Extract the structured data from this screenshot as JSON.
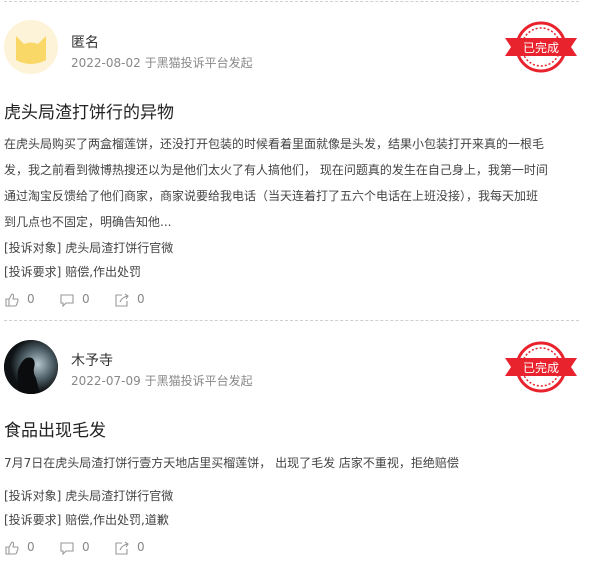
{
  "posts": [
    {
      "user": "匿名",
      "date": "2022-08-02",
      "platform_note": "于黑猫投诉平台发起",
      "status": "已完成",
      "title": "虎头局渣打饼行的异物",
      "desc_lines": [
        "在虎头局购买了两盒榴莲饼，还没打开包装的时候看着里面就像是头发，结果小包装打开来真的一根毛",
        "发，我之前看到微博热搜还以为是他们太火了有人搞他们， 现在问题真的发生在自己身上，我第一时间",
        "通过淘宝反馈给了他们商家，商家说要给我电话（当天连着打了五六个电话在上班没接），我每天加班",
        "到几点也不固定，明确告知他..."
      ],
      "target_label": "[投诉对象]",
      "target_value": "虎头局渣打饼行官微",
      "request_label": "[投诉要求]",
      "request_value": "赔偿,作出处罚",
      "likes": "0",
      "comments": "0",
      "shares": "0",
      "avatar_icon": "cat-face-icon"
    },
    {
      "user": "木予寺",
      "date": "2022-07-09",
      "platform_note": "于黑猫投诉平台发起",
      "status": "已完成",
      "title": "食品出现毛发",
      "desc_lines": [
        "7月7日在虎头局渣打饼行壹方天地店里买榴莲饼， 出现了毛发 店家不重视，拒绝赔偿"
      ],
      "target_label": "[投诉对象]",
      "target_value": "虎头局渣打饼行官微",
      "request_label": "[投诉要求]",
      "request_value": "赔偿,作出处罚,道歉",
      "likes": "0",
      "comments": "0",
      "shares": "0",
      "avatar_icon": "silhouette-photo-icon"
    }
  ],
  "colors": {
    "stamp_red": "#e8232d",
    "cat_yellow": "#f9d867",
    "cat_bg": "#fdf3d8"
  }
}
